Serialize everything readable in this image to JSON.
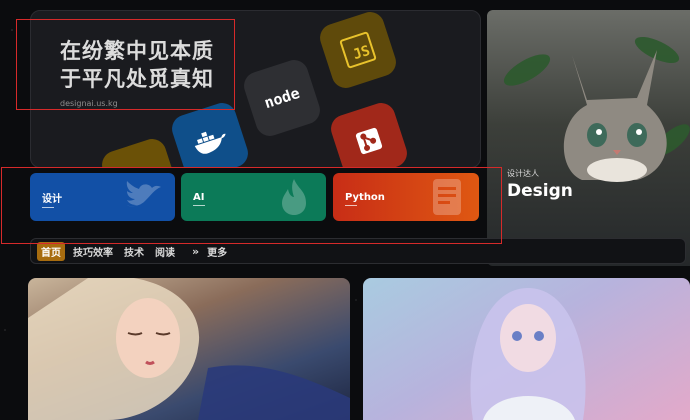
{
  "hero": {
    "title_line1": "在纷繁中见本质",
    "title_line2": "于平凡处觅真知",
    "domain": "designai.us.kg",
    "tiles": {
      "js_label": "JS",
      "node_label": "node"
    }
  },
  "feature": {
    "subtitle": "设计达人",
    "title": "Design"
  },
  "categories": [
    {
      "label": "设计",
      "color": "#1250a6"
    },
    {
      "label": "AI",
      "color": "#0c7a58"
    },
    {
      "label": "Python",
      "color": "#d84416"
    }
  ],
  "nav": {
    "items": [
      "首页",
      "技巧效率",
      "技术",
      "阅读"
    ],
    "more_icon": "»",
    "more_label": "更多",
    "active_color": "#a76c0f"
  },
  "annotations": {
    "color": "#d62a2a"
  }
}
